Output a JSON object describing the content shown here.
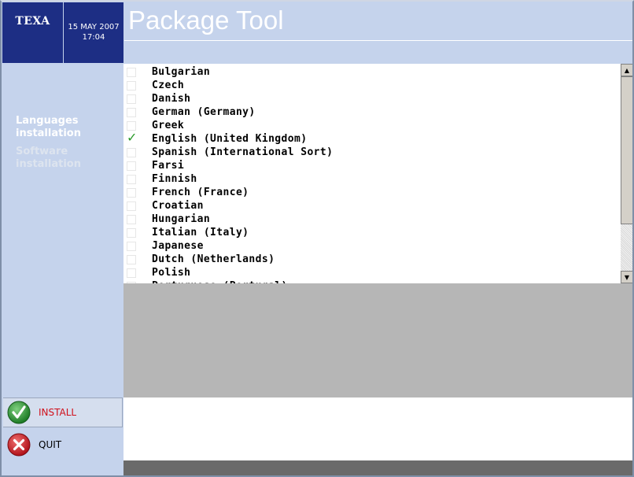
{
  "brand": {
    "logo_text": "TEXA"
  },
  "datetime": {
    "date": "15 MAY 2007",
    "time": "17:04"
  },
  "header": {
    "title": "Package Tool"
  },
  "nav": {
    "items": [
      {
        "label": "Languages installation",
        "active": true
      },
      {
        "label": "Software installation",
        "active": false
      }
    ]
  },
  "actions": {
    "install_label": "INSTALL",
    "quit_label": "QUIT"
  },
  "languages": [
    {
      "label": "Bulgarian",
      "checked": false
    },
    {
      "label": "Czech",
      "checked": false
    },
    {
      "label": "Danish",
      "checked": false
    },
    {
      "label": "German (Germany)",
      "checked": false
    },
    {
      "label": "Greek",
      "checked": false
    },
    {
      "label": "English (United Kingdom)",
      "checked": true
    },
    {
      "label": "Spanish (International Sort)",
      "checked": false
    },
    {
      "label": "Farsi",
      "checked": false
    },
    {
      "label": "Finnish",
      "checked": false
    },
    {
      "label": "French (France)",
      "checked": false
    },
    {
      "label": "Croatian",
      "checked": false
    },
    {
      "label": "Hungarian",
      "checked": false
    },
    {
      "label": "Italian (Italy)",
      "checked": false
    },
    {
      "label": "Japanese",
      "checked": false
    },
    {
      "label": "Dutch (Netherlands)",
      "checked": false
    },
    {
      "label": "Polish",
      "checked": false
    },
    {
      "label": "Portuguese (Portugal)",
      "checked": false
    }
  ],
  "colors": {
    "brand_blue": "#1d2e84",
    "panel_blue": "#c5d3ec",
    "install_red": "#d0101a",
    "check_green": "#2a9a2a"
  }
}
